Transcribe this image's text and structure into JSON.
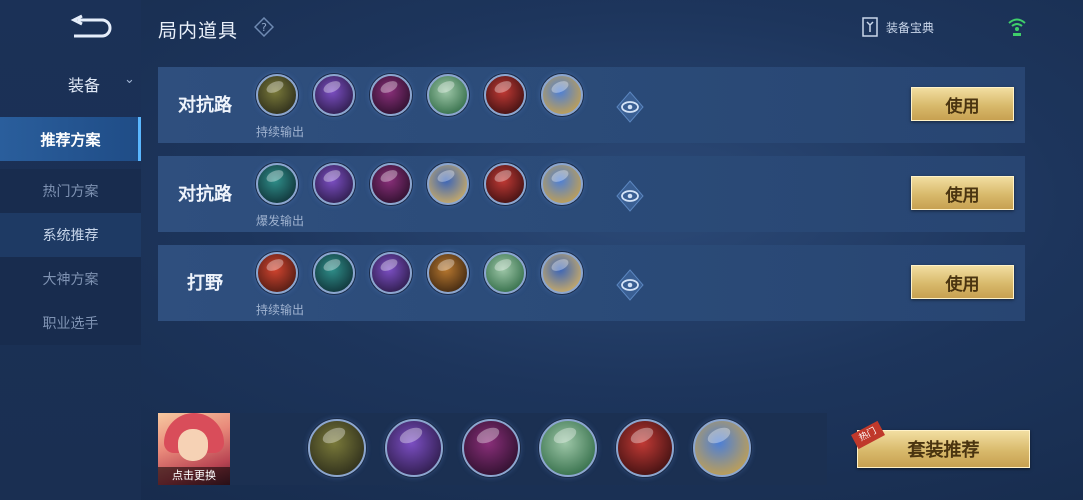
{
  "header": {
    "title": "局内道具",
    "codex_label": "装备宝典"
  },
  "sidebar": {
    "section_label": "装备",
    "items": [
      {
        "label": "推荐方案"
      },
      {
        "label": "热门方案"
      },
      {
        "label": "系统推荐"
      },
      {
        "label": "大神方案"
      },
      {
        "label": "职业选手"
      }
    ]
  },
  "plans": [
    {
      "lane": "对抗路",
      "style": "持续输出",
      "button": "使用",
      "items": [
        "greaves-boots",
        "purple-axe",
        "crimson-wing-armor",
        "green-silver-blade",
        "red-shield-mask",
        "blue-gold-crest"
      ]
    },
    {
      "lane": "对抗路",
      "style": "爆发输出",
      "button": "使用",
      "items": [
        "teal-boots",
        "purple-axe",
        "crimson-wing-armor",
        "blue-gold-sword",
        "red-shield-mask",
        "blue-gold-crest"
      ]
    },
    {
      "lane": "打野",
      "style": "持续输出",
      "button": "使用",
      "items": [
        "red-jungle-blade",
        "teal-boots",
        "purple-axe",
        "orange-bronze-armor",
        "green-silver-blade",
        "blue-gold-sword"
      ]
    }
  ],
  "bottom": {
    "hero_swap_label": "点击更换",
    "items": [
      "greaves-boots",
      "purple-axe",
      "crimson-wing-armor",
      "green-silver-blade",
      "red-shield-mask",
      "blue-gold-crest"
    ],
    "set_button": "套装推荐",
    "hot_tag": "热门"
  },
  "item_colors": {
    "greaves-boots": [
      "#7a7a3a",
      "#2a2a1a"
    ],
    "teal-boots": [
      "#2f8f8a",
      "#0f2f35"
    ],
    "purple-axe": [
      "#7c4fc4",
      "#2a1a45"
    ],
    "crimson-wing-armor": [
      "#8a2f7a",
      "#2a0f2a"
    ],
    "green-silver-blade": [
      "#9ec7a8",
      "#2f6a45"
    ],
    "red-shield-mask": [
      "#c23a35",
      "#3a0f10"
    ],
    "blue-gold-crest": [
      "#4d7fd6",
      "#c9a24a"
    ],
    "blue-gold-sword": [
      "#3a64b8",
      "#d3b062"
    ],
    "red-jungle-blade": [
      "#d2442f",
      "#4a1a12"
    ],
    "orange-bronze-armor": [
      "#b8782f",
      "#3a2410"
    ]
  }
}
